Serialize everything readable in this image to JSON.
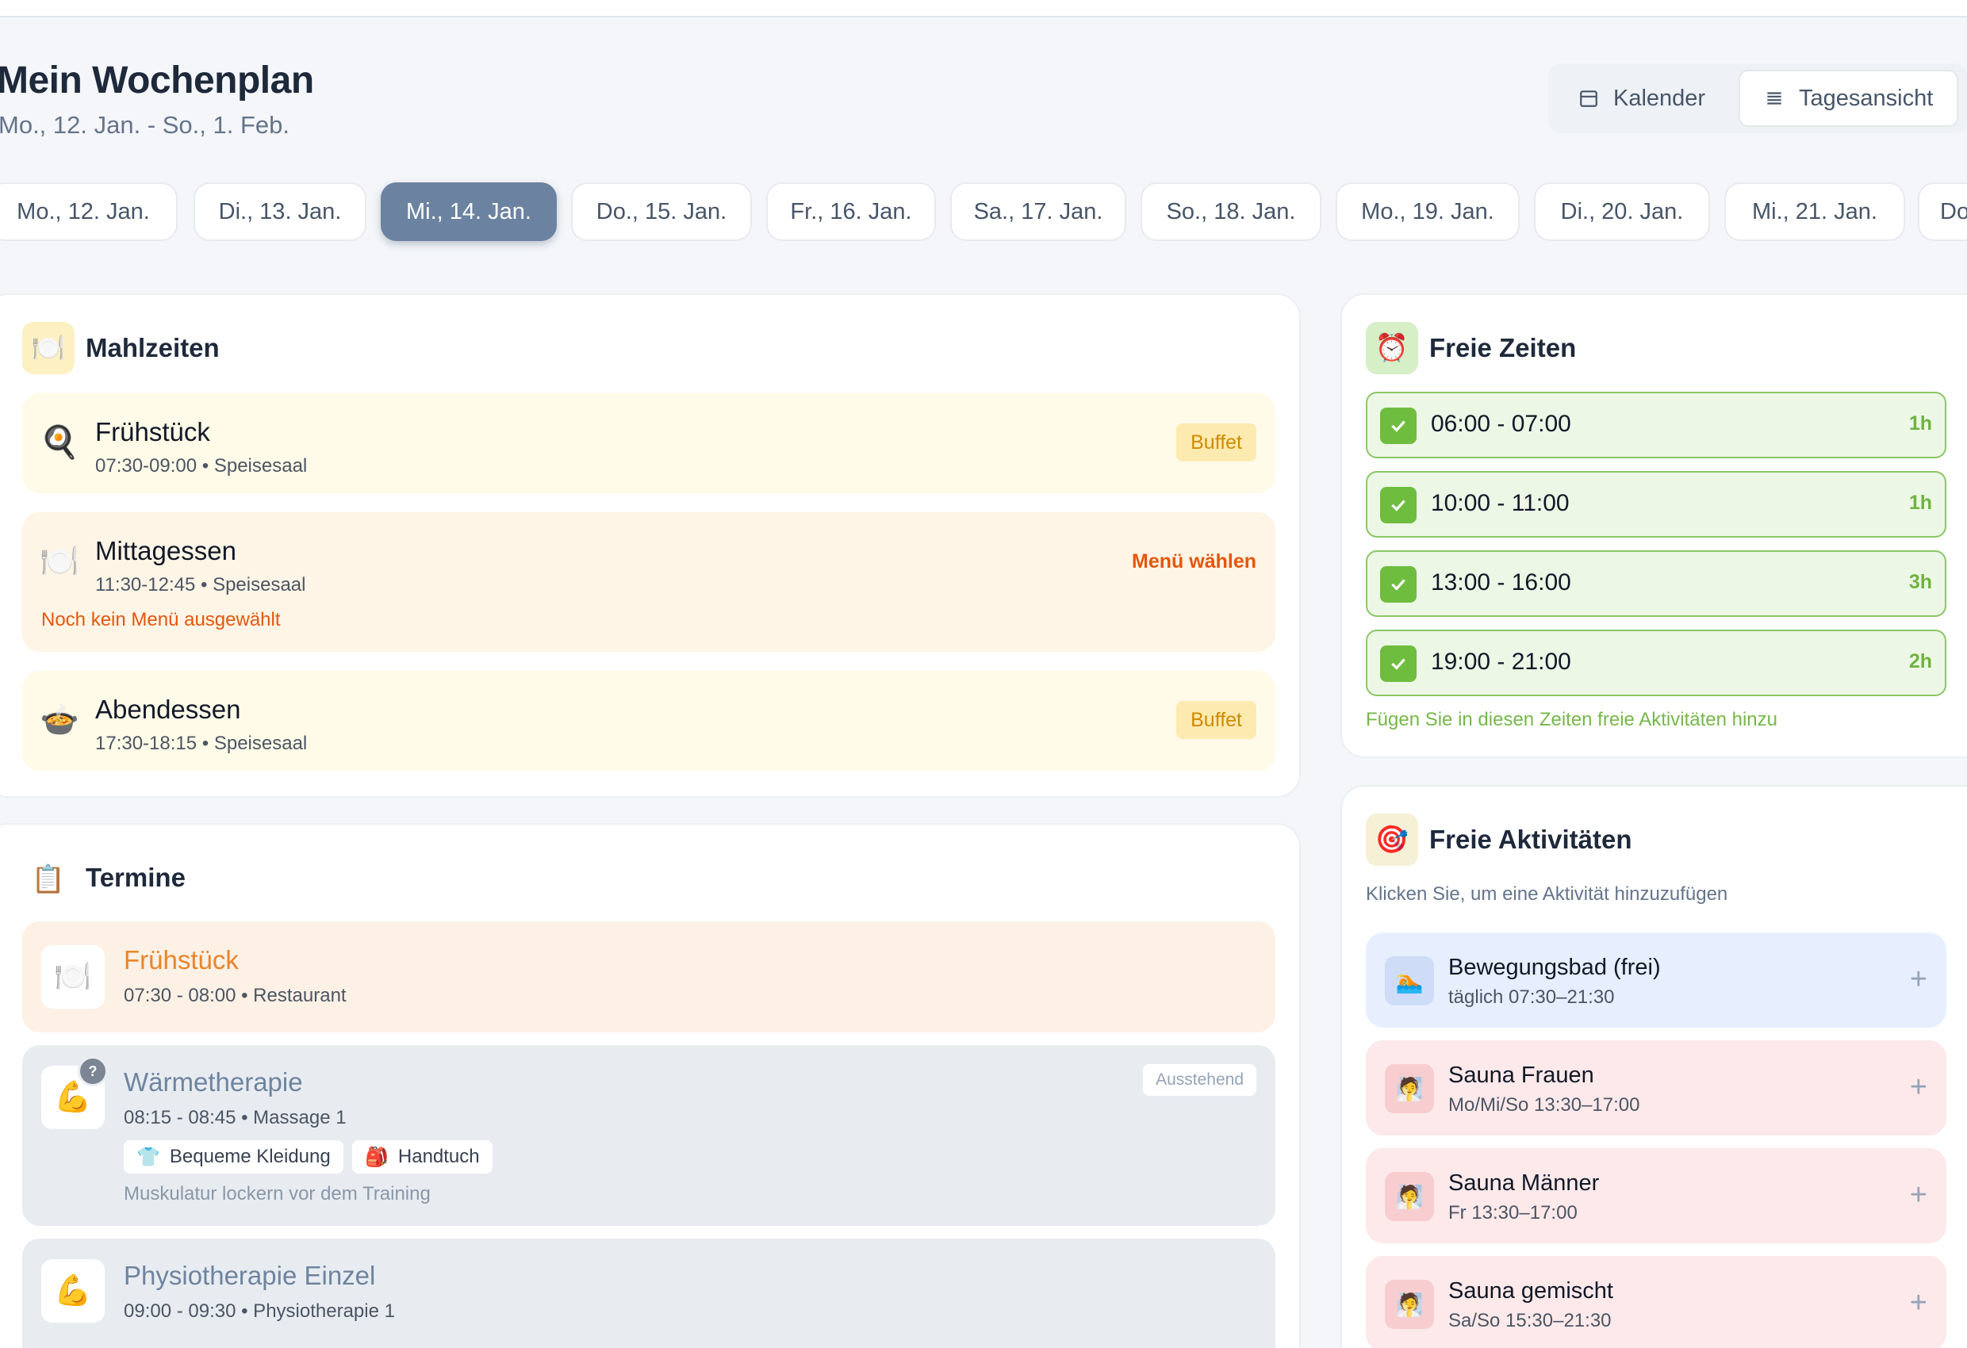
{
  "header": {
    "title": "Mein Wochenplan",
    "subtitle": "Mo., 12. Jan. - So., 1. Feb."
  },
  "view_toggle": {
    "calendar_label": "Kalender",
    "day_label": "Tagesansicht",
    "active": "Tagesansicht"
  },
  "date_tabs": [
    {
      "label": "Mo., 12. Jan."
    },
    {
      "label": "Di., 13. Jan."
    },
    {
      "label": "Mi., 14. Jan.",
      "active": true
    },
    {
      "label": "Do., 15. Jan."
    },
    {
      "label": "Fr., 16. Jan."
    },
    {
      "label": "Sa., 17. Jan."
    },
    {
      "label": "So., 18. Jan."
    },
    {
      "label": "Mo., 19. Jan."
    },
    {
      "label": "Di., 20. Jan."
    },
    {
      "label": "Mi., 21. Jan."
    },
    {
      "label": "Do"
    }
  ],
  "meals": {
    "title": "Mahlzeiten",
    "icon": "plate-icon",
    "items": [
      {
        "name": "Frühstück",
        "meta": "07:30-09:00 • Speisesaal",
        "badge": "Buffet",
        "icon": "frying-pan-icon",
        "emoji": "🍳"
      },
      {
        "name": "Mittagessen",
        "meta": "11:30-12:45 • Speisesaal",
        "action": "Menü wählen",
        "note": "Noch kein Menü ausgewählt",
        "icon": "plate-cutlery-icon",
        "emoji": "🍽️"
      },
      {
        "name": "Abendessen",
        "meta": "17:30-18:15 • Speisesaal",
        "badge": "Buffet",
        "icon": "bowl-icon",
        "emoji": "🍲"
      }
    ]
  },
  "free_times": {
    "title": "Freie Zeiten",
    "icon": "alarm-clock-icon",
    "slots": [
      {
        "time": "06:00 - 07:00",
        "duration": "1h"
      },
      {
        "time": "10:00 - 11:00",
        "duration": "1h"
      },
      {
        "time": "13:00 - 16:00",
        "duration": "3h"
      },
      {
        "time": "19:00 - 21:00",
        "duration": "2h"
      }
    ],
    "hint": "Fügen Sie in diesen Zeiten freie Aktivitäten hinzu"
  },
  "appointments": {
    "title": "Termine",
    "icon": "clipboard-icon",
    "items": [
      {
        "title": "Frühstück",
        "meta": "07:30 - 08:00 • Restaurant",
        "icon": "plate-cutlery-icon",
        "emoji": "🍽️"
      },
      {
        "title": "Wärmetherapie",
        "meta": "08:15 - 08:45 • Massage 1",
        "status": "Ausstehend",
        "q": "?",
        "chips": [
          {
            "label": "Bequeme Kleidung",
            "emoji": "👕"
          },
          {
            "label": "Handtuch",
            "emoji": "🎒"
          }
        ],
        "note": "Muskulatur lockern vor dem Training",
        "icon": "flexed-bicep-icon",
        "emoji": "💪"
      },
      {
        "title": "Physiotherapie Einzel",
        "meta": "09:00 - 09:30 • Physiotherapie 1",
        "icon": "flexed-bicep-icon",
        "emoji": "💪"
      }
    ]
  },
  "free_activities": {
    "title": "Freie Aktivitäten",
    "icon": "target-icon",
    "hint": "Klicken Sie, um eine Aktivität hinzuzufügen",
    "items": [
      {
        "name": "Bewegungsbad (frei)",
        "time": "täglich 07:30–21:30",
        "icon": "swimmer-icon",
        "emoji": "🏊",
        "color": "#e7efff",
        "icon_bg": "#cfdcf7"
      },
      {
        "name": "Sauna Frauen",
        "time": "Mo/Mi/So 13:30–17:00",
        "icon": "sauna-icon",
        "emoji": "🧖",
        "color": "#fde9ea",
        "icon_bg": "#f8cdd0"
      },
      {
        "name": "Sauna Männer",
        "time": "Fr 13:30–17:00",
        "icon": "sauna-icon",
        "emoji": "🧖",
        "color": "#fde9ea",
        "icon_bg": "#f8cdd0"
      },
      {
        "name": "Sauna gemischt",
        "time": "Sa/So 15:30–21:30",
        "icon": "sauna-icon",
        "emoji": "🧖",
        "color": "#fde9ea",
        "icon_bg": "#f8cdd0"
      }
    ]
  },
  "colors": {
    "accent_active_tab": "#6b83a0",
    "free_slot_green": "#6fbd3f",
    "warning_orange": "#e4570b",
    "buffet_badge": "#d08a00"
  }
}
